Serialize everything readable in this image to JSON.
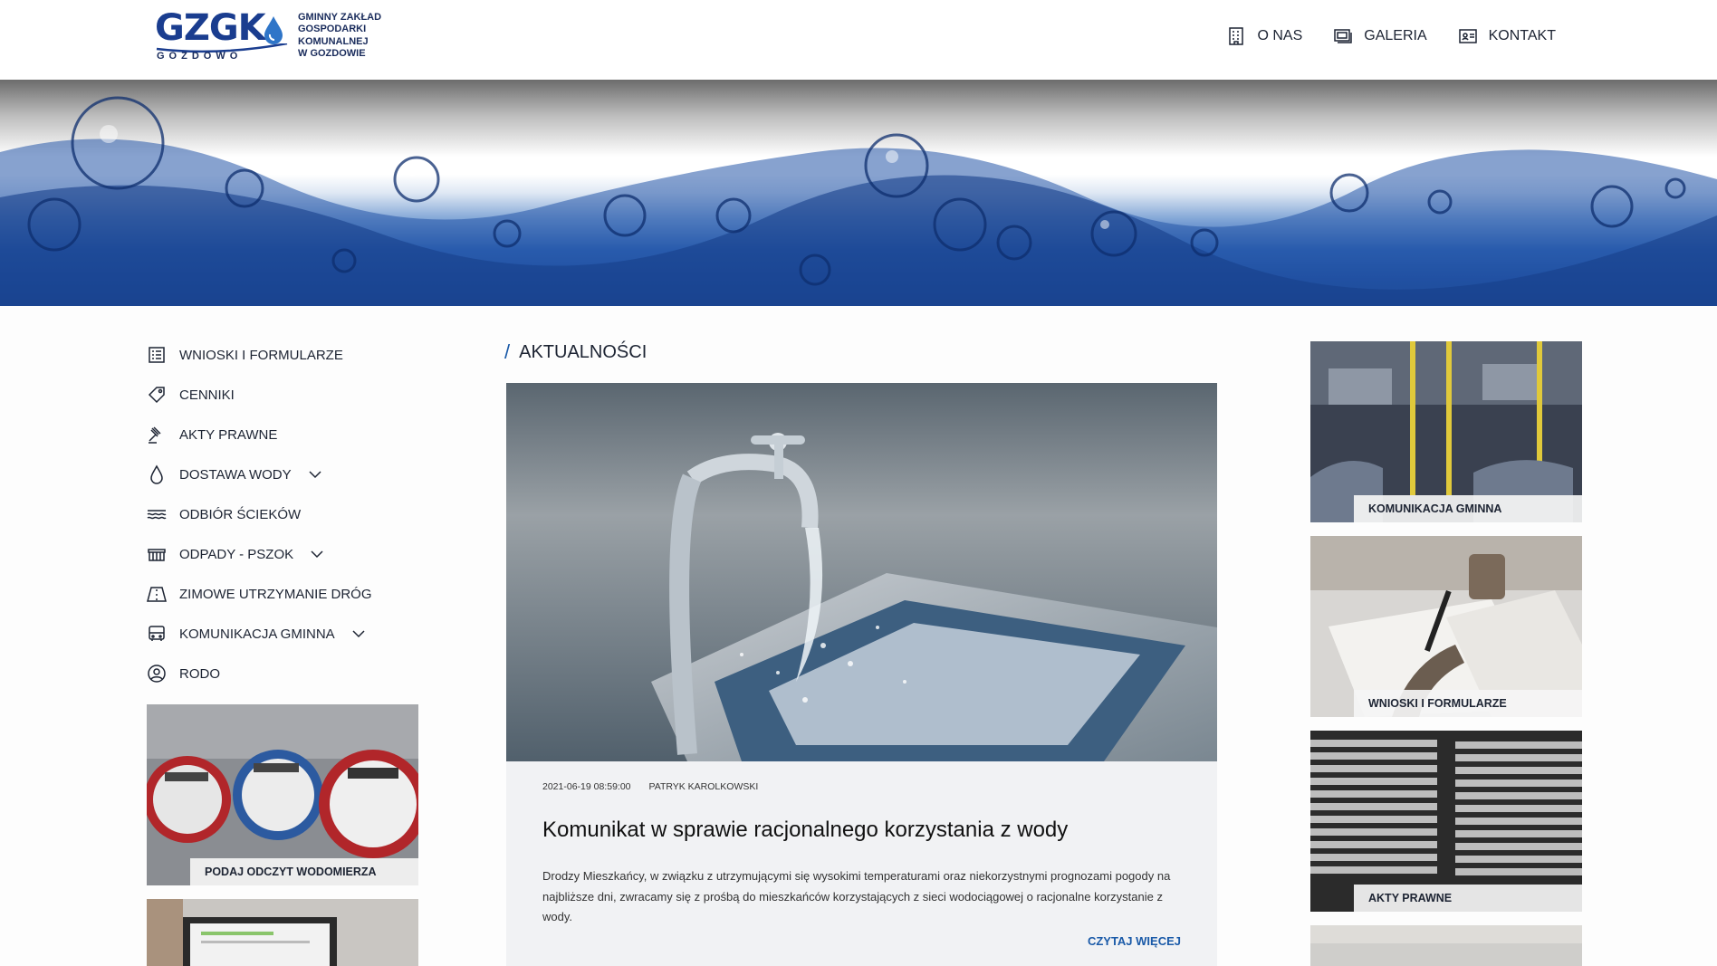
{
  "logo": {
    "brand": "GZGK",
    "location": "GOZDOWO",
    "full_name_lines": [
      "GMINNY ZAKŁAD",
      "GOSPODARKI",
      "KOMUNALNEJ",
      "W GOZDOWIE"
    ]
  },
  "topnav": {
    "items": [
      {
        "label": "O NAS",
        "icon": "building-icon"
      },
      {
        "label": "GALERIA",
        "icon": "gallery-icon"
      },
      {
        "label": "KONTAKT",
        "icon": "contact-card-icon"
      }
    ]
  },
  "sidebar": {
    "items": [
      {
        "label": "WNIOSKI I FORMULARZE",
        "icon": "form-icon",
        "has_dropdown": false
      },
      {
        "label": "CENNIKI",
        "icon": "price-tag-icon",
        "has_dropdown": false
      },
      {
        "label": "AKTY PRAWNE",
        "icon": "gavel-icon",
        "has_dropdown": false
      },
      {
        "label": "DOSTAWA WODY",
        "icon": "water-drop-icon",
        "has_dropdown": true
      },
      {
        "label": "ODBIÓR ŚCIEKÓW",
        "icon": "waves-icon",
        "has_dropdown": false
      },
      {
        "label": "ODPADY - PSZOK",
        "icon": "container-icon",
        "has_dropdown": true
      },
      {
        "label": "ZIMOWE UTRZYMANIE DRÓG",
        "icon": "road-icon",
        "has_dropdown": false
      },
      {
        "label": "KOMUNIKACJA GMINNA",
        "icon": "bus-icon",
        "has_dropdown": true
      },
      {
        "label": "RODO",
        "icon": "user-circle-icon",
        "has_dropdown": false
      }
    ],
    "tiles": [
      {
        "label": "PODAJ ODCZYT WODOMIERZA"
      },
      {
        "label": ""
      }
    ]
  },
  "main": {
    "section_title": "AKTUALNOŚCI",
    "article": {
      "date": "2021-06-19 08:59:00",
      "author": "PATRYK KAROLKOWSKI",
      "title": "Komunikat w sprawie racjonalnego korzystania z wody",
      "excerpt": "Drodzy Mieszkańcy, w związku z utrzymującymi się wysokimi temperaturami oraz niekorzystnymi prognozami pogody na najbliższe dni, zwracamy się z prośbą do mieszkańców korzystających z sieci wodociągowej o racjonalne korzystanie z wody.",
      "read_more": "CZYTAJ WIĘCEJ"
    }
  },
  "right_tiles": [
    {
      "label": "KOMUNIKACJA GMINNA"
    },
    {
      "label": "WNIOSKI I FORMULARZE"
    },
    {
      "label": "AKTY PRAWNE"
    },
    {
      "label": ""
    }
  ],
  "colors": {
    "accent": "#1a5aa8",
    "text": "#1d2433",
    "brand_blue": "#1a3d8f"
  }
}
